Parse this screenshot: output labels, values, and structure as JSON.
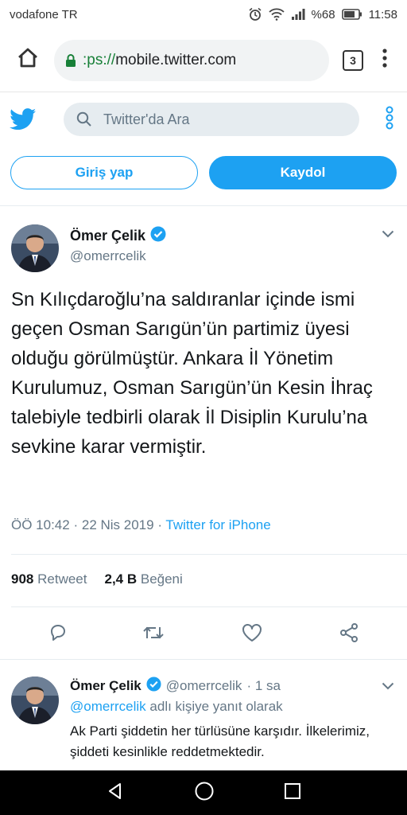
{
  "status_bar": {
    "carrier": "vodafone TR",
    "battery": "%68",
    "time": "11:58"
  },
  "browser": {
    "url_scheme": ":ps://",
    "url_host": "mobile.twitter.com",
    "tabs_count": "3"
  },
  "twitter": {
    "search_placeholder": "Twitter'da Ara",
    "login_label": "Giriş yap",
    "signup_label": "Kaydol",
    "accent": "#1da1f2"
  },
  "main_tweet": {
    "name": "Ömer Çelik",
    "handle": "@omerrcelik",
    "text": "Sn Kılıçdaroğlu’na saldıranlar içinde ismi geçen Osman Sarıgün’ün partimiz üyesi olduğu görülmüştür. Ankara İl Yönetim Kurulumuz, Osman Sarıgün’ün Kesin İhraç talebiyle tedbirli olarak İl Disiplin Kurulu’na sevkine karar vermiştir.",
    "time": "ÖÖ 10:42",
    "date": "22 Nis 2019",
    "separator": "·",
    "source": "Twitter for iPhone",
    "retweet_count": "908",
    "retweet_label": "Retweet",
    "like_count": "2,4 B",
    "like_label": "Beğeni"
  },
  "reply_tweet": {
    "name": "Ömer Çelik",
    "handle": "@omerrcelik",
    "age": "· 1 sa",
    "reply_mention": "@omerrcelik",
    "reply_suffix": "adlı kişiye yanıt olarak",
    "text": "Ak Parti şiddetin her türlüsüne karşıdır. İlkelerimiz, şiddeti kesinlikle reddetmektedir."
  }
}
